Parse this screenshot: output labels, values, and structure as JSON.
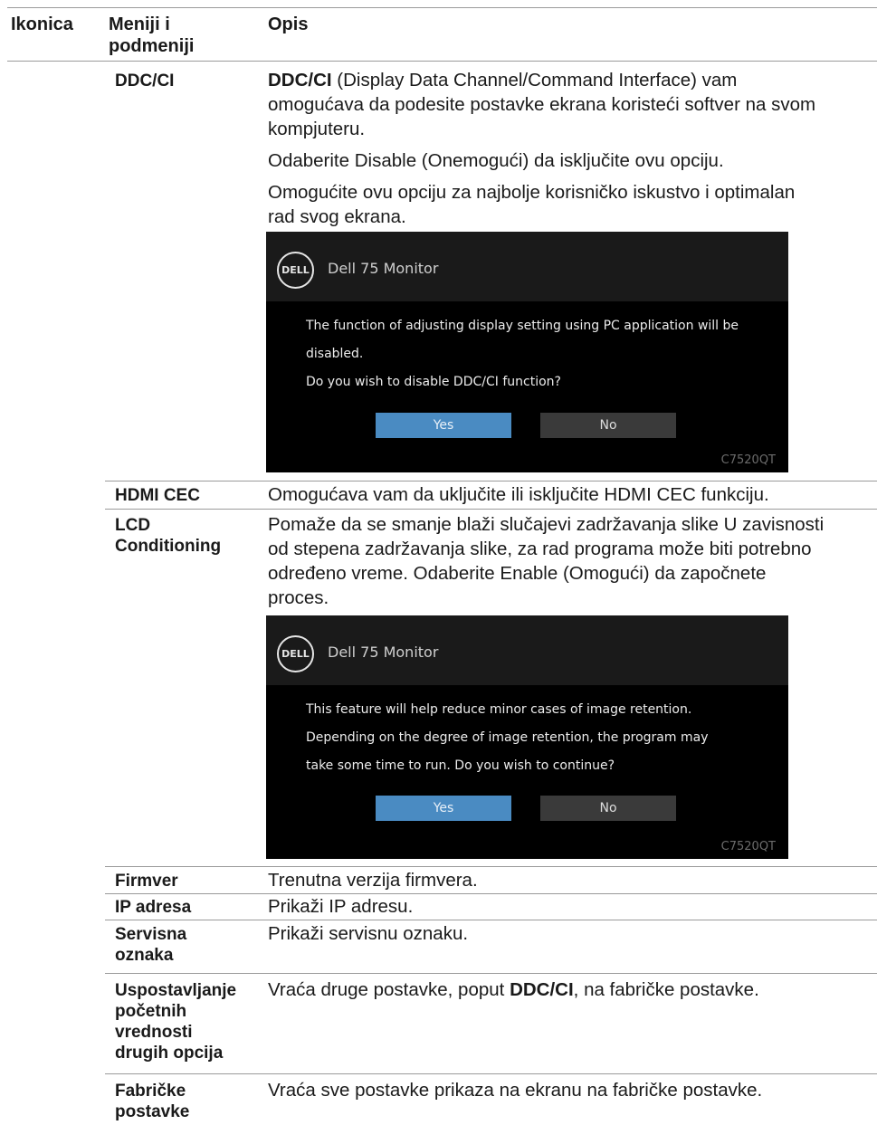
{
  "header": {
    "icon_col": "Ikonica",
    "menu_col_line1": "Meniji i",
    "menu_col_line2": "podmeniji",
    "desc_col": "Opis"
  },
  "rows": {
    "ddcci": {
      "menu": "DDC/CI",
      "p1_bold": "DDC/CI",
      "p1_l1": " (Display Data Channel/Command Interface) vam",
      "p1_l2": "omogućava da podesite postavke ekrana koristeći softver na svom",
      "p1_l3": "kompjuteru.",
      "p2_pre": "Odaberite ",
      "p2_bold": "Disable",
      "p2_post": " (Onemogući) da isključite ovu opciju.",
      "p3_l1": "Omogućite ovu opciju za najbolje korisničko iskustvo i optimalan",
      "p3_l2": "rad svog ekrana."
    },
    "hdmi_cec": {
      "menu": "HDMI CEC",
      "desc": "Omogućava vam da uključite ili isključite HDMI CEC funkciju."
    },
    "lcd": {
      "menu_l1": "LCD",
      "menu_l2": "Conditioning",
      "l1": "Pomaže da se smanje blaži slučajevi zadržavanja slike U zavisnosti",
      "l2": "od stepena zadržavanja slike, za rad programa može biti potrebno",
      "l3_pre": "određeno vreme.  Odaberite ",
      "l3_bold": "Enable",
      "l3_post": " (Omogući) da započnete",
      "l4": "proces."
    },
    "firmware": {
      "menu": "Firmver",
      "desc": "Trenutna verzija firmvera."
    },
    "ip": {
      "menu": "IP adresa",
      "desc": "Prikaži IP adresu."
    },
    "service_tag": {
      "menu_l1": "Servisna",
      "menu_l2": "oznaka",
      "desc": "Prikaži servisnu oznaku."
    },
    "other_reset": {
      "menu_l1": "Uspostavljanje",
      "menu_l2": "početnih",
      "menu_l3": "vrednosti",
      "menu_l4": "drugih opcija",
      "desc_pre": "Vraća druge postavke, poput ",
      "desc_bold": "DDC/CI",
      "desc_post": ", na fabričke postavke."
    },
    "factory_reset": {
      "menu_l1": "Fabričke",
      "menu_l2": "postavke",
      "desc": "Vraća sve postavke prikaza na ekranu na fabričke postavke."
    }
  },
  "osd1": {
    "logo_text": "DELL",
    "title": "Dell 75 Monitor",
    "line1": "The function of adjusting display setting using PC application will be",
    "line2": "disabled.",
    "line3": "Do you wish to disable DDC/CI function?",
    "yes": "Yes",
    "no": "No",
    "model": "C7520QT"
  },
  "osd2": {
    "logo_text": "DELL",
    "title": "Dell 75 Monitor",
    "line1": "This feature will help reduce minor cases of image retention.",
    "line2": "Depending on the degree of image retention, the program may",
    "line3": "take some time to run. Do you wish to continue?",
    "yes": "Yes",
    "no": "No",
    "model": "C7520QT"
  }
}
